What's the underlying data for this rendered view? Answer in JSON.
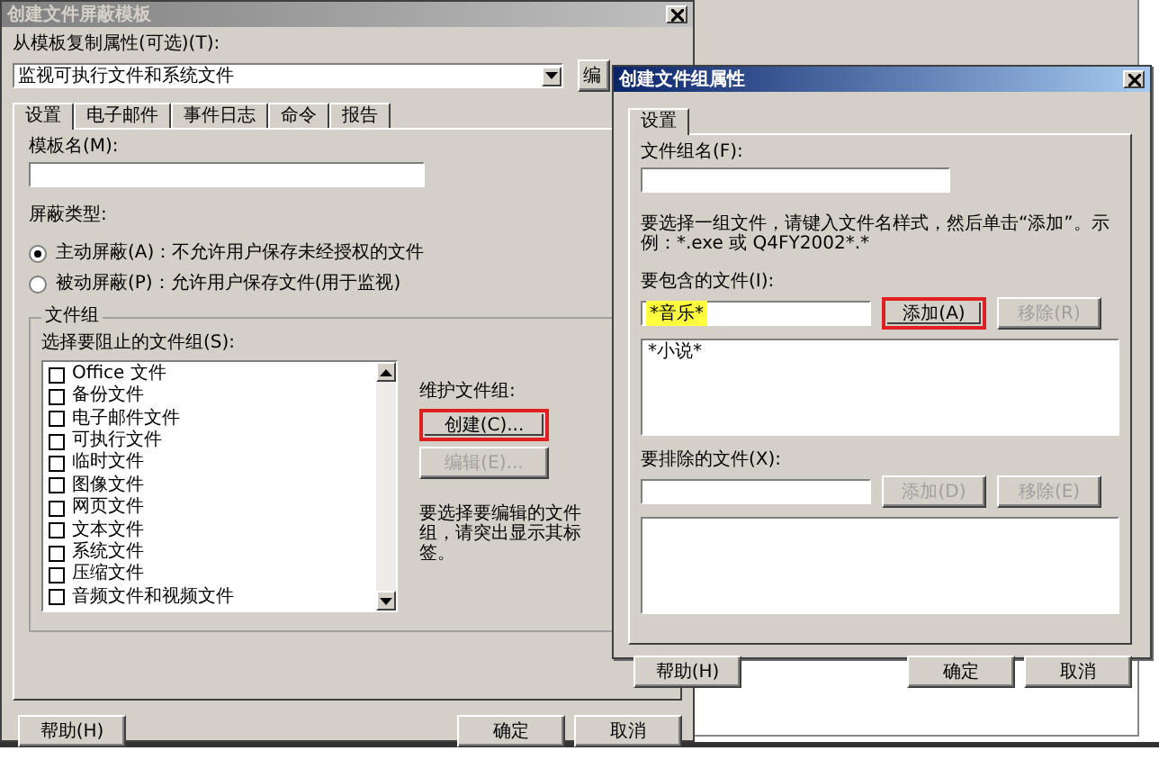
{
  "template_dialog": {
    "title": "创建文件屏蔽模板",
    "active": false,
    "copy_label": "从模板复制属性(可选)(T):",
    "copy_value": "监视可执行文件和系统文件",
    "copy_button": "编",
    "tabs": [
      {
        "label": "设置",
        "selected": true
      },
      {
        "label": "电子邮件",
        "selected": false
      },
      {
        "label": "事件日志",
        "selected": false
      },
      {
        "label": "命令",
        "selected": false
      },
      {
        "label": "报告",
        "selected": false
      }
    ],
    "name_label": "模板名(M):",
    "screen_type_label": "屏蔽类型:",
    "radios": [
      {
        "label": "主动屏蔽(A)：不允许用户保存未经授权的文件",
        "selected": true
      },
      {
        "label": "被动屏蔽(P)：允许用户保存文件(用于监视)",
        "selected": false
      }
    ],
    "group_box_title": "文件组",
    "list_label": "选择要阻止的文件组(S):",
    "file_groups": [
      {
        "label": "Office 文件",
        "checked": false
      },
      {
        "label": "备份文件",
        "checked": false
      },
      {
        "label": "电子邮件文件",
        "checked": false
      },
      {
        "label": "可执行文件",
        "checked": false
      },
      {
        "label": "临时文件",
        "checked": false
      },
      {
        "label": "图像文件",
        "checked": false
      },
      {
        "label": "网页文件",
        "checked": false
      },
      {
        "label": "文本文件",
        "checked": false
      },
      {
        "label": "系统文件",
        "checked": false
      },
      {
        "label": "压缩文件",
        "checked": false
      },
      {
        "label": "音频文件和视频文件",
        "checked": false
      }
    ],
    "maintain_label": "维护文件组:",
    "maintain_buttons": [
      {
        "label": "创建(C)...",
        "disabled": false,
        "highlighted": true
      },
      {
        "label": "编辑(E)...",
        "disabled": true,
        "highlighted": false
      }
    ],
    "hint": "要选择要编辑的文件组，请突出显示其标签。",
    "footer_buttons": [
      {
        "label": "帮助(H)",
        "disabled": false,
        "highlighted": false
      },
      {
        "label": "确定",
        "disabled": false,
        "highlighted": false
      },
      {
        "label": "取消",
        "disabled": false,
        "highlighted": false
      }
    ]
  },
  "group_dialog": {
    "title": "创建文件组属性",
    "active": true,
    "tabs": [
      {
        "label": "设置",
        "selected": true
      }
    ],
    "name_label": "文件组名(F):",
    "instructions": "要选择一组文件，请键入文件名样式，然后单击“添加”。示例：*.exe 或 Q4FY2002*.*",
    "include_label": "要包含的文件(I):",
    "include_value": "*音乐*",
    "include_value_highlighted": true,
    "include_buttons": [
      {
        "label": "添加(A)",
        "disabled": false,
        "highlighted": true
      },
      {
        "label": "移除(R)",
        "disabled": true,
        "highlighted": false
      }
    ],
    "include_list": [
      "*小说*"
    ],
    "exclude_label": "要排除的文件(X):",
    "exclude_buttons": [
      {
        "label": "添加(D)",
        "disabled": true,
        "highlighted": false
      },
      {
        "label": "移除(E)",
        "disabled": true,
        "highlighted": false
      }
    ],
    "footer_buttons": [
      {
        "label": "帮助(H)",
        "disabled": false,
        "highlighted": false
      },
      {
        "label": "确定",
        "disabled": false,
        "highlighted": false
      },
      {
        "label": "取消",
        "disabled": false,
        "highlighted": false
      }
    ]
  }
}
